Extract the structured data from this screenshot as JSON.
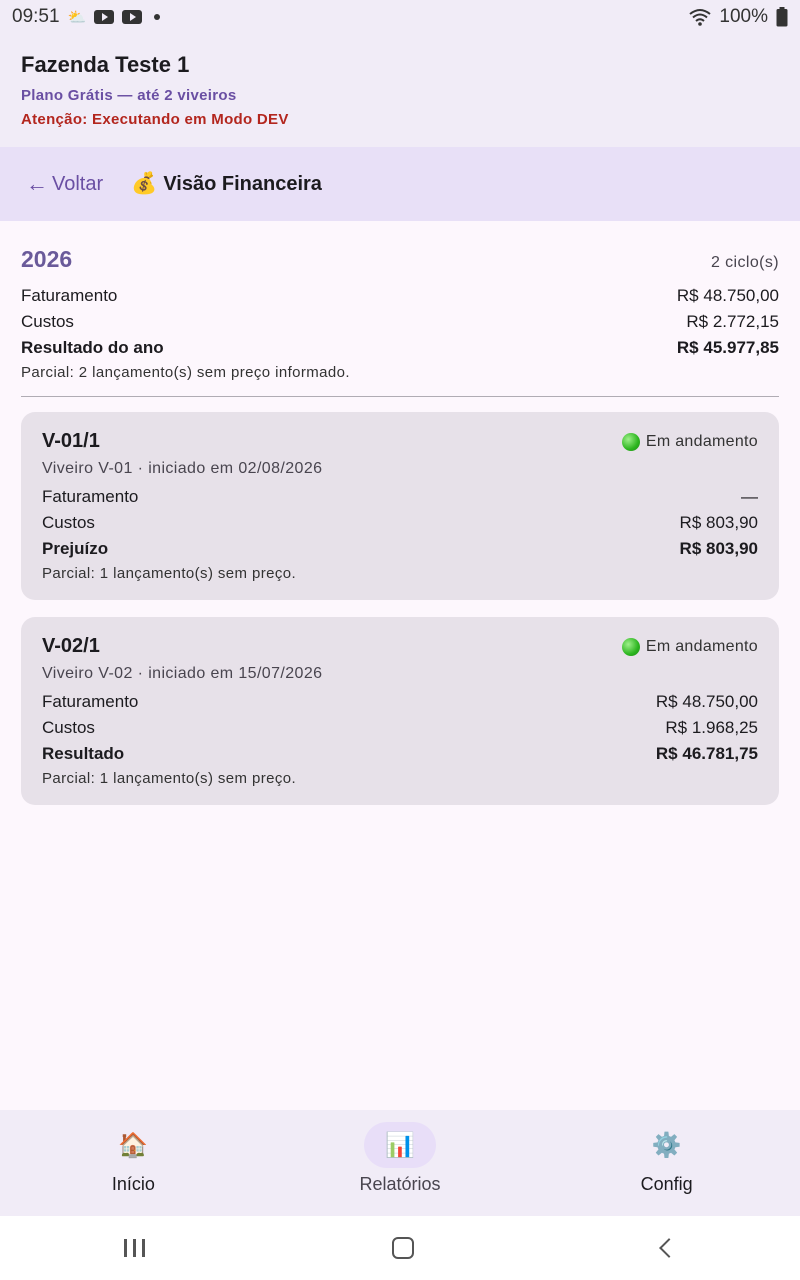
{
  "statusbar": {
    "time": "09:51",
    "battery": "100%"
  },
  "header": {
    "farm_name": "Fazenda Teste 1",
    "plan": "Plano Grátis — até 2 viveiros",
    "dev_warning": "Atenção: Executando em Modo DEV"
  },
  "nav": {
    "back_label": "Voltar",
    "title": "Visão Financeira"
  },
  "summary": {
    "year": "2026",
    "cycles": "2 ciclo(s)",
    "revenue_label": "Faturamento",
    "revenue_value": "R$ 48.750,00",
    "costs_label": "Custos",
    "costs_value": "R$ 2.772,15",
    "result_label": "Resultado do ano",
    "result_value": "R$ 45.977,85",
    "note": "Parcial: 2 lançamento(s) sem preço informado."
  },
  "cycles": [
    {
      "title": "V-01/1",
      "status": "Em andamento",
      "subtitle": "Viveiro V-01 · iniciado em 02/08/2026",
      "revenue_label": "Faturamento",
      "revenue_value": "—",
      "costs_label": "Custos",
      "costs_value": "R$ 803,90",
      "result_label": "Prejuízo",
      "result_value": "R$ 803,90",
      "note": "Parcial: 1 lançamento(s) sem preço."
    },
    {
      "title": "V-02/1",
      "status": "Em andamento",
      "subtitle": "Viveiro V-02 · iniciado em 15/07/2026",
      "revenue_label": "Faturamento",
      "revenue_value": "R$ 48.750,00",
      "costs_label": "Custos",
      "costs_value": "R$ 1.968,25",
      "result_label": "Resultado",
      "result_value": "R$ 46.781,75",
      "note": "Parcial: 1 lançamento(s) sem preço."
    }
  ],
  "bottom_nav": {
    "home_label": "Início",
    "reports_label": "Relatórios",
    "config_label": "Config",
    "active": "reports"
  }
}
